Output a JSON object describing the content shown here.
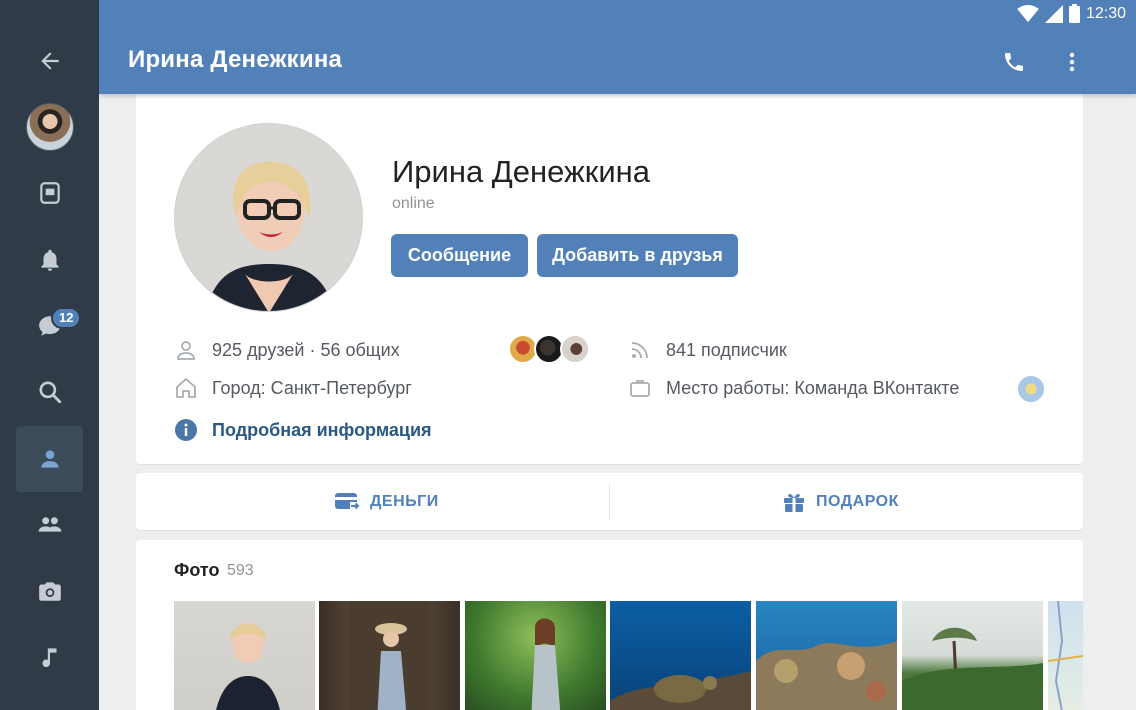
{
  "status_bar": {
    "time": "12:30"
  },
  "app_bar": {
    "title": "Ирина Денежкина"
  },
  "nav": {
    "items": [
      {
        "icon": "back-arrow-icon"
      },
      {
        "icon": "user-avatar"
      },
      {
        "icon": "news-icon"
      },
      {
        "icon": "bell-icon"
      },
      {
        "icon": "messages-icon",
        "badge": "12"
      },
      {
        "icon": "search-icon"
      },
      {
        "icon": "profile-icon",
        "active": true
      },
      {
        "icon": "friends-icon"
      },
      {
        "icon": "camera-icon"
      },
      {
        "icon": "music-icon"
      }
    ],
    "badge": "12"
  },
  "profile": {
    "name": "Ирина Денежкина",
    "status": "online",
    "message_button": "Сообщение",
    "add_friend_button": "Добавить в друзья",
    "friends": "925 друзей · 56 общих",
    "followers": "841 подписчик",
    "city": "Город: Санкт-Петербург",
    "work": "Место работы: Команда ВКонтакте",
    "more_info": "Подробная информация"
  },
  "actions": {
    "money": "ДЕНЬГИ",
    "gift": "ПОДАРОК"
  },
  "photos": {
    "title": "Фото",
    "count": "593"
  },
  "colors": {
    "brand": "#5181b8",
    "rail": "#2f3c48",
    "background": "#edeef0",
    "link": "#2a5885"
  }
}
